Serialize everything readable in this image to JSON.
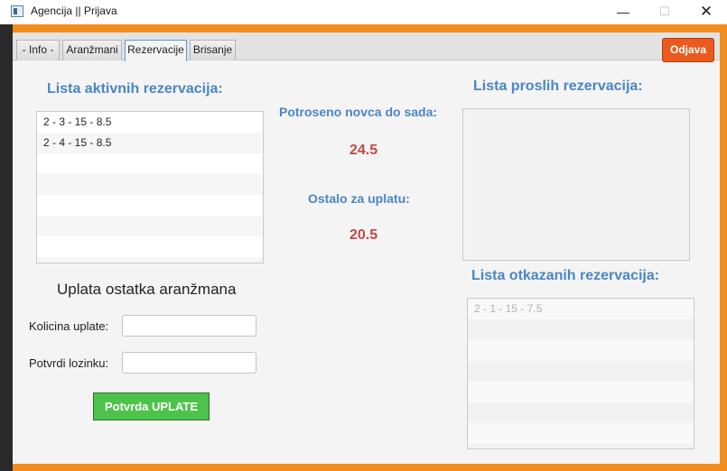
{
  "window": {
    "title": "Agencija || Prijava",
    "minimize_glyph": "—",
    "maximize_glyph": "☐",
    "close_glyph": "✕"
  },
  "tabs": [
    {
      "label": "- Info -"
    },
    {
      "label": "Aranžmani"
    },
    {
      "label": "Rezervacije",
      "active": true
    },
    {
      "label": "Brisanje"
    }
  ],
  "logout_label": "Odjava",
  "active_reservations": {
    "heading": "Lista aktivnih rezervacija:",
    "items": [
      "2 - 3 - 15 - 8.5",
      "2 - 4 - 15 - 8.5"
    ]
  },
  "stats": {
    "spent_label": "Potroseno novca do sada:",
    "spent_value": "24.5",
    "remaining_label": "Ostalo za uplatu:",
    "remaining_value": "20.5"
  },
  "past_reservations": {
    "heading": "Lista proslih rezervacija:",
    "items": []
  },
  "cancelled_reservations": {
    "heading": "Lista otkazanih rezervacija:",
    "items": [
      "2 - 1 - 15 - 7.5"
    ]
  },
  "payment": {
    "title": "Uplata ostatka aranžmana",
    "amount_label": "Kolicina uplate:",
    "amount_value": "",
    "password_label": "Potvrdi lozinku:",
    "password_value": "",
    "confirm_label": "Potvrda UPLATE"
  },
  "colors": {
    "accent_blue": "#4a86c5",
    "value_red": "#c14a44",
    "logout_orange": "#ea5a1f",
    "confirm_green": "#4dc34b",
    "frame_orange": "#f28c1e"
  }
}
